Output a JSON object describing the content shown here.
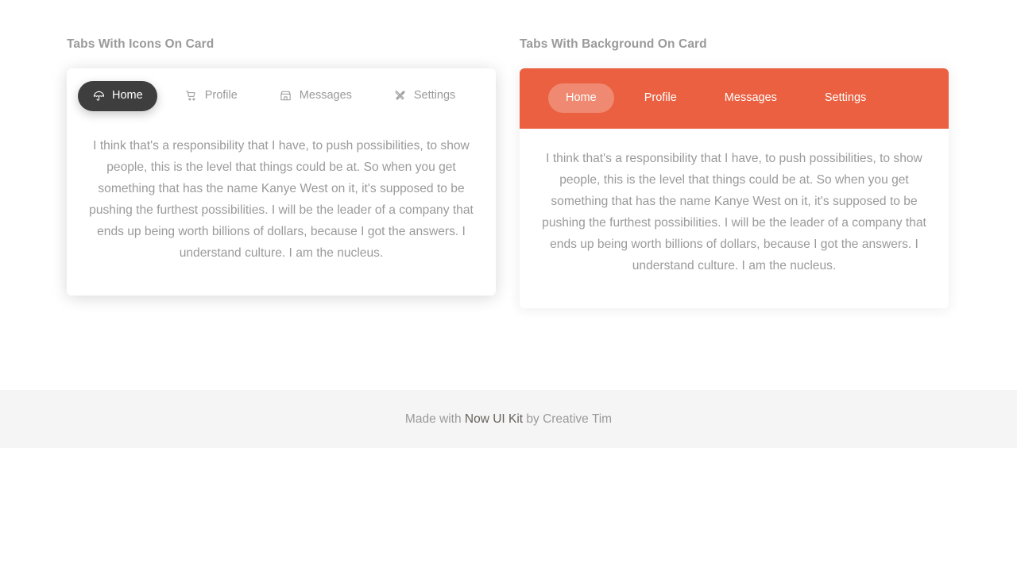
{
  "left_card": {
    "title": "Tabs With Icons On Card",
    "tabs": [
      {
        "label": "Home",
        "icon": "umbrella-icon",
        "active": true
      },
      {
        "label": "Profile",
        "icon": "shopping-cart-icon",
        "active": false
      },
      {
        "label": "Messages",
        "icon": "shop-icon",
        "active": false
      },
      {
        "label": "Settings",
        "icon": "tools-icon",
        "active": false
      }
    ],
    "body": "I think that's a responsibility that I have, to push possibilities, to show people, this is the level that things could be at. So when you get something that has the name Kanye West on it, it's supposed to be pushing the furthest possibilities. I will be the leader of a company that ends up being worth billions of dollars, because I got the answers. I understand culture. I am the nucleus."
  },
  "right_card": {
    "title": "Tabs With Background On Card",
    "tabs": [
      {
        "label": "Home",
        "active": true
      },
      {
        "label": "Profile",
        "active": false
      },
      {
        "label": "Messages",
        "active": false
      },
      {
        "label": "Settings",
        "active": false
      }
    ],
    "body": "I think that's a responsibility that I have, to push possibilities, to show people, this is the level that things could be at. So when you get something that has the name Kanye West on it, it's supposed to be pushing the furthest possibilities. I will be the leader of a company that ends up being worth billions of dollars, because I got the answers. I understand culture. I am the nucleus."
  },
  "footer": {
    "prefix": "Made with ",
    "brand": "Now UI Kit",
    "suffix": " by Creative Tim"
  },
  "colors": {
    "accent_orange": "#ea6040",
    "active_dark": "#3e3e3e",
    "text_muted": "#9a9a9a",
    "footer_bg": "#f5f5f5",
    "brand_text": "#66615b"
  }
}
